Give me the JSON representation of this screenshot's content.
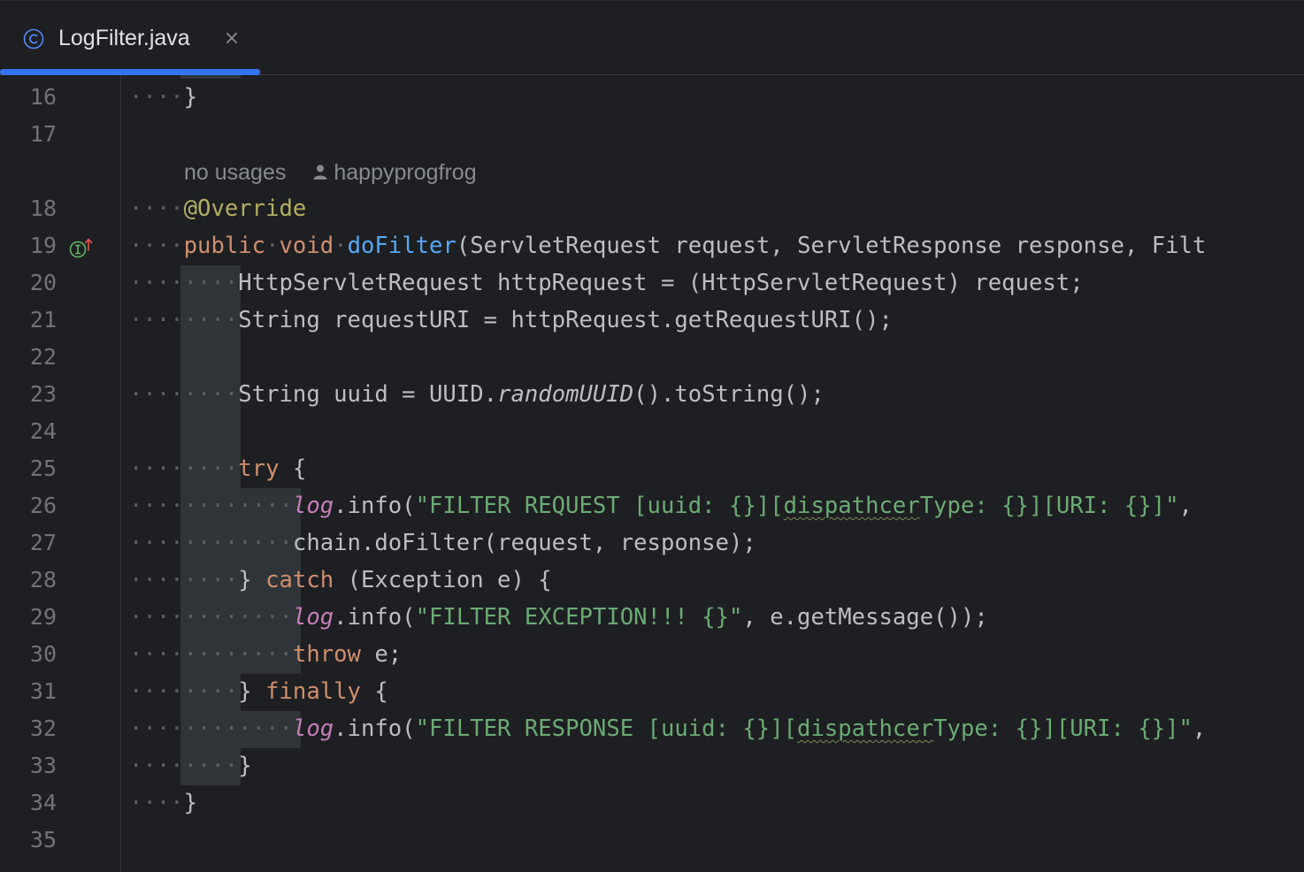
{
  "tab": {
    "file_name": "LogFilter.java",
    "file_icon": "class-icon",
    "close_glyph": "×",
    "accent_color": "#3574f0"
  },
  "inlay_hint": {
    "usages": "no usages",
    "author": "happyprogfrog"
  },
  "gutter": {
    "line_numbers": [
      "16",
      "17",
      "18",
      "19",
      "20",
      "21",
      "22",
      "23",
      "24",
      "25",
      "26",
      "27",
      "28",
      "29",
      "30",
      "31",
      "32",
      "33",
      "34",
      "35"
    ],
    "icons": [
      "implements-method-icon"
    ]
  },
  "code": {
    "l16": "}",
    "l18_annotation": "@Override",
    "l19": {
      "public": "public",
      "void": "void",
      "method": "doFilter",
      "params": "(ServletRequest request, ServletResponse response, Filt"
    },
    "l20": "HttpServletRequest httpRequest = (HttpServletRequest) request;",
    "l21": "String requestURI = httpRequest.getRequestURI();",
    "l23": {
      "pre": "String uuid = UUID.",
      "method": "randomUUID",
      "post": "().toString();"
    },
    "l25": {
      "kw": "try",
      "rest": " {"
    },
    "l26": {
      "field": "log",
      "call": ".info(",
      "str_a": "\"FILTER REQUEST [uuid: {}][",
      "str_typo": "dispathcer",
      "str_b": "Type: {}][URI: {}]\"",
      "rest": ", "
    },
    "l27": "chain.doFilter(request, response);",
    "l28": {
      "pre": "} ",
      "kw": "catch",
      "rest": " (Exception e) {"
    },
    "l29": {
      "field": "log",
      "call": ".info(",
      "str": "\"FILTER EXCEPTION!!! {}\"",
      "rest": ", e.getMessage());"
    },
    "l30": {
      "kw": "throw",
      "rest": " e;"
    },
    "l31": {
      "pre": "} ",
      "kw": "finally",
      "rest": " {"
    },
    "l32": {
      "field": "log",
      "call": ".info(",
      "str_a": "\"FILTER RESPONSE [uuid: {}][",
      "str_typo": "dispathcer",
      "str_b": "Type: {}][URI: {}]\"",
      "rest": ","
    },
    "l33": "}",
    "l34": "}"
  }
}
